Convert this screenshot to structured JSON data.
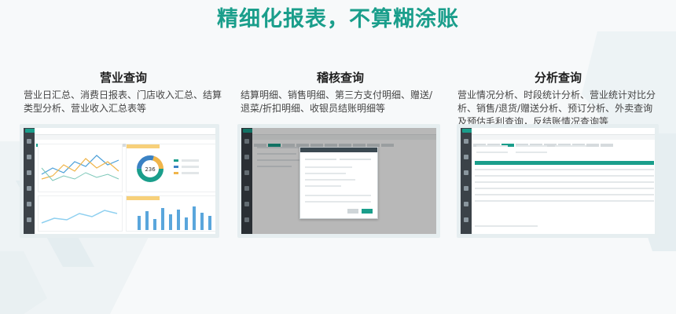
{
  "hero": {
    "title": "精细化报表，不算糊涂账"
  },
  "columns": [
    {
      "title": "营业查询",
      "description": "营业日汇总、消费日报表、门店收入汇总、结算类型分析、营业收入汇总表等"
    },
    {
      "title": "稽核查询",
      "description": "结算明细、销售明细、第三方支付明细、赠送/退菜/折扣明细、收银员结账明细等"
    },
    {
      "title": "分析查询",
      "description": "营业情况分析、时段统计分析、营业统计对比分析、销售/退货/赠送分析、预订分析、外卖查询及预估毛利查询，反结账情况查询等"
    }
  ],
  "screens": {
    "business": {
      "donut_value": "236"
    }
  },
  "colors": {
    "brand": "#1a9e8b",
    "chart_line_1": "#4a9fd8",
    "chart_line_2": "#f0b54a",
    "bar": "#5aa6dc",
    "donut_1": "#1a9e8b",
    "donut_2": "#3b82c4",
    "donut_3": "#f0b54a"
  }
}
